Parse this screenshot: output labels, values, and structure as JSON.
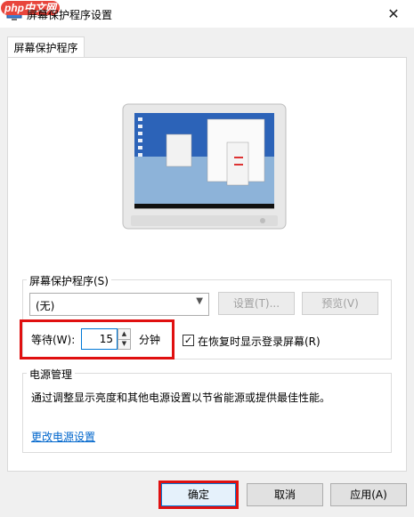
{
  "window": {
    "title": "屏幕保护程序设置",
    "close_glyph": "✕",
    "watermark": "php中文网"
  },
  "tabs": [
    {
      "label": "屏幕保护程序"
    }
  ],
  "screensaver": {
    "group_label": "屏幕保护程序(S)",
    "selected": "(无)",
    "settings_label": "设置(T)...",
    "preview_label": "预览(V)",
    "wait_label": "等待(W):",
    "wait_value": "15",
    "wait_unit": "分钟",
    "resume_label": "在恢复时显示登录屏幕(R)",
    "resume_checked": true
  },
  "power": {
    "group_label": "电源管理",
    "description": "通过调整显示亮度和其他电源设置以节省能源或提供最佳性能。",
    "link": "更改电源设置"
  },
  "footer": {
    "ok_label": "确定",
    "cancel_label": "取消",
    "apply_label": "应用(A)"
  },
  "colors": {
    "highlight_border": "#e01010",
    "focus_blue": "#0078d7",
    "link_blue": "#0066cc"
  },
  "icons": [
    "screensaver-icon",
    "close-icon",
    "spin-up-icon",
    "spin-down-icon",
    "dropdown-arrow-icon",
    "checkmark-icon",
    "monitor-icon"
  ]
}
